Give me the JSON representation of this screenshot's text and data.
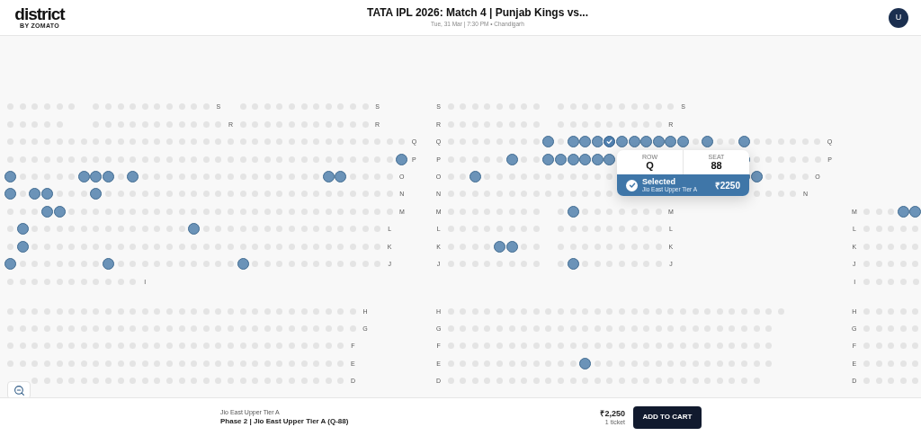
{
  "header": {
    "logo": "district",
    "logo_subtitle": "BY ZOMATO",
    "title": "TATA IPL 2026: Match 4 | Punjab Kings vs...",
    "subtitle": "Tue, 31 Mar | 7:30 PM • Chandigarh",
    "avatar": "U"
  },
  "seat_map": {
    "sections": [
      {
        "rows": [
          {
            "segments": [
              {
                "kind": "seats",
                "available": [
                  false,
                  false,
                  false,
                  false,
                  false,
                  false
                ]
              },
              {
                "kind": "space"
              },
              {
                "kind": "seats",
                "available": [
                  false,
                  false,
                  false,
                  false,
                  false,
                  false,
                  false,
                  false,
                  false,
                  false
                ]
              },
              {
                "kind": "label",
                "text": "S"
              },
              {
                "kind": "space"
              },
              {
                "kind": "seats",
                "available": [
                  false,
                  false,
                  false,
                  false,
                  false,
                  false,
                  false,
                  false,
                  false,
                  false,
                  false
                ]
              },
              {
                "kind": "label",
                "text": "S"
              },
              {
                "kind": "space"
              },
              {
                "kind": "label",
                "text": "S"
              },
              {
                "kind": "seats",
                "available": [
                  false,
                  false,
                  false,
                  false,
                  false,
                  false,
                  false,
                  false
                ]
              },
              {
                "kind": "space"
              },
              {
                "kind": "seats",
                "available": [
                  false,
                  false,
                  false,
                  false,
                  false,
                  false,
                  false,
                  false,
                  false,
                  false
                ]
              },
              {
                "kind": "label",
                "text": "S"
              }
            ]
          },
          {
            "segments": [
              {
                "kind": "seats",
                "available": [
                  false,
                  false,
                  false,
                  false,
                  false
                ]
              },
              {
                "kind": "space"
              },
              {
                "kind": "seats",
                "available": [
                  false,
                  false,
                  false,
                  false,
                  false,
                  false,
                  false,
                  false,
                  false,
                  false,
                  false
                ]
              },
              {
                "kind": "label",
                "text": "R"
              },
              {
                "kind": "seats",
                "available": [
                  false,
                  false,
                  false,
                  false,
                  false,
                  false,
                  false,
                  false,
                  false,
                  false,
                  false
                ]
              },
              {
                "kind": "label",
                "text": "R"
              },
              {
                "kind": "space"
              },
              {
                "kind": "label",
                "text": "R"
              },
              {
                "kind": "seats",
                "available": [
                  false,
                  false,
                  false,
                  false,
                  false,
                  false,
                  false,
                  false
                ]
              },
              {
                "kind": "space"
              },
              {
                "kind": "seats",
                "available": [
                  false,
                  false,
                  false,
                  false,
                  false,
                  false,
                  false,
                  false,
                  false
                ]
              },
              {
                "kind": "label",
                "text": "R"
              }
            ]
          },
          {
            "segments": [
              {
                "kind": "seats",
                "available": [
                  false,
                  false,
                  false,
                  false,
                  false,
                  false,
                  false,
                  false,
                  false,
                  false,
                  false,
                  false,
                  false,
                  false,
                  false,
                  false,
                  false,
                  false,
                  false,
                  false,
                  false,
                  false,
                  false,
                  false,
                  false,
                  false,
                  false,
                  false,
                  false,
                  false,
                  false,
                  false,
                  false
                ]
              },
              {
                "kind": "label",
                "text": "Q"
              },
              {
                "kind": "space"
              },
              {
                "kind": "label",
                "text": "Q"
              },
              {
                "kind": "seats",
                "available": [
                  false,
                  false,
                  false,
                  false,
                  false,
                  false,
                  false,
                  false,
                  true,
                  false,
                  true,
                  true,
                  true
                ]
              },
              {
                "kind": "seat",
                "selected": true
              },
              {
                "kind": "seats",
                "available": [
                  true,
                  true,
                  true,
                  true,
                  true,
                  true,
                  false,
                  true,
                  false,
                  false,
                  true,
                  false,
                  false,
                  false,
                  false,
                  false,
                  false
                ]
              },
              {
                "kind": "label",
                "text": "Q"
              }
            ]
          },
          {
            "segments": [
              {
                "kind": "seats",
                "available": [
                  false,
                  false,
                  false,
                  false,
                  false,
                  false,
                  false,
                  false,
                  false,
                  false,
                  false,
                  false,
                  false,
                  false,
                  false,
                  false,
                  false,
                  false,
                  false,
                  false,
                  false,
                  false,
                  false,
                  false,
                  false,
                  false,
                  false,
                  false,
                  false,
                  false,
                  false,
                  false,
                  true
                ]
              },
              {
                "kind": "label",
                "text": "P"
              },
              {
                "kind": "space"
              },
              {
                "kind": "label",
                "text": "P"
              },
              {
                "kind": "seats",
                "available": [
                  false,
                  false,
                  false,
                  false,
                  false,
                  true,
                  false,
                  false,
                  true,
                  true,
                  true,
                  true,
                  true,
                  true
                ]
              },
              {
                "kind": "space"
              },
              {
                "kind": "seats",
                "available": [
                  true,
                  false,
                  false,
                  false,
                  false,
                  false,
                  false
                ]
              },
              {
                "kind": "label",
                "text": "P"
              }
            ]
          },
          {
            "segments": [
              {
                "kind": "seats",
                "available": [
                  true,
                  false,
                  false,
                  false,
                  false,
                  false,
                  true,
                  true,
                  true,
                  false,
                  true,
                  false,
                  false,
                  false,
                  false,
                  false,
                  false,
                  false,
                  false,
                  false,
                  false,
                  false,
                  false,
                  false,
                  false,
                  false,
                  true,
                  true,
                  false,
                  false,
                  false,
                  false
                ]
              },
              {
                "kind": "label",
                "text": "O"
              },
              {
                "kind": "space"
              },
              {
                "kind": "label",
                "text": "O"
              },
              {
                "kind": "seats",
                "available": [
                  false,
                  false,
                  true,
                  false,
                  false,
                  false,
                  false,
                  false,
                  false,
                  false,
                  false,
                  false,
                  false,
                  false
                ]
              },
              {
                "kind": "space"
              },
              {
                "kind": "seats",
                "available": [
                  true,
                  true,
                  false,
                  false,
                  false,
                  false
                ]
              },
              {
                "kind": "label",
                "text": "O"
              }
            ]
          },
          {
            "segments": [
              {
                "kind": "seats",
                "available": [
                  true,
                  false,
                  true,
                  true,
                  false,
                  false,
                  false,
                  true,
                  false,
                  false,
                  false,
                  false,
                  false,
                  false,
                  false,
                  false,
                  false,
                  false,
                  false,
                  false,
                  false,
                  false,
                  false,
                  false,
                  false,
                  false,
                  false,
                  false,
                  false,
                  false,
                  false,
                  false
                ]
              },
              {
                "kind": "label",
                "text": "N"
              },
              {
                "kind": "space"
              },
              {
                "kind": "label",
                "text": "N"
              },
              {
                "kind": "seats",
                "available": [
                  false,
                  false,
                  false,
                  false,
                  false,
                  false,
                  false,
                  false,
                  false,
                  false,
                  false,
                  false,
                  false,
                  false
                ]
              },
              {
                "kind": "space"
              },
              {
                "kind": "seats",
                "available": [
                  false,
                  false,
                  false,
                  false
                ]
              },
              {
                "kind": "label",
                "text": "N"
              }
            ]
          },
          {
            "segments": [
              {
                "kind": "seats",
                "available": [
                  false,
                  false,
                  false,
                  true,
                  true,
                  false,
                  false,
                  false,
                  false,
                  false,
                  false,
                  false,
                  false,
                  false,
                  false,
                  false,
                  false,
                  false,
                  false,
                  false,
                  false,
                  false,
                  false,
                  false,
                  false,
                  false,
                  false,
                  false,
                  false,
                  false,
                  false,
                  false
                ]
              },
              {
                "kind": "label",
                "text": "M"
              },
              {
                "kind": "space"
              },
              {
                "kind": "label",
                "text": "M"
              },
              {
                "kind": "seats",
                "available": [
                  false,
                  false,
                  false,
                  false,
                  false,
                  false,
                  false,
                  false
                ]
              },
              {
                "kind": "space"
              },
              {
                "kind": "seats",
                "available": [
                  false,
                  true,
                  false,
                  false,
                  false,
                  false,
                  false,
                  false,
                  false
                ]
              },
              {
                "kind": "label",
                "text": "M"
              },
              {
                "kind": "space"
              },
              {
                "kind": "label",
                "text": "M"
              },
              {
                "kind": "seats",
                "available": [
                  false,
                  false,
                  false,
                  true,
                  true
                ]
              }
            ]
          },
          {
            "segments": [
              {
                "kind": "seats",
                "available": [
                  false,
                  true,
                  false,
                  false,
                  false,
                  false,
                  false,
                  false,
                  false,
                  false,
                  false,
                  false,
                  false,
                  false,
                  false,
                  true,
                  false,
                  false,
                  false,
                  false,
                  false,
                  false,
                  false,
                  false,
                  false,
                  false,
                  false,
                  false,
                  false,
                  false,
                  false
                ]
              },
              {
                "kind": "label",
                "text": "L"
              },
              {
                "kind": "space"
              },
              {
                "kind": "label",
                "text": "L"
              },
              {
                "kind": "seats",
                "available": [
                  false,
                  false,
                  false,
                  false,
                  false,
                  false,
                  false,
                  false
                ]
              },
              {
                "kind": "space"
              },
              {
                "kind": "seats",
                "available": [
                  false,
                  false,
                  false,
                  false,
                  false,
                  false,
                  false,
                  false,
                  false
                ]
              },
              {
                "kind": "label",
                "text": "L"
              },
              {
                "kind": "space"
              },
              {
                "kind": "label",
                "text": "L"
              },
              {
                "kind": "seats",
                "available": [
                  false,
                  false,
                  false,
                  false,
                  false
                ]
              }
            ]
          },
          {
            "segments": [
              {
                "kind": "seats",
                "available": [
                  false,
                  true,
                  false,
                  false,
                  false,
                  false,
                  false,
                  false,
                  false,
                  false,
                  false,
                  false,
                  false,
                  false,
                  false,
                  false,
                  false,
                  false,
                  false,
                  false,
                  false,
                  false,
                  false,
                  false,
                  false,
                  false,
                  false,
                  false,
                  false,
                  false,
                  false
                ]
              },
              {
                "kind": "label",
                "text": "K"
              },
              {
                "kind": "space"
              },
              {
                "kind": "label",
                "text": "K"
              },
              {
                "kind": "seats",
                "available": [
                  false,
                  false,
                  false,
                  false,
                  true,
                  true,
                  false,
                  false
                ]
              },
              {
                "kind": "space"
              },
              {
                "kind": "seats",
                "available": [
                  false,
                  false,
                  false,
                  false,
                  false,
                  false,
                  false,
                  false,
                  false
                ]
              },
              {
                "kind": "label",
                "text": "K"
              },
              {
                "kind": "space"
              },
              {
                "kind": "label",
                "text": "K"
              },
              {
                "kind": "seats",
                "available": [
                  false,
                  false,
                  false,
                  false,
                  false
                ]
              }
            ]
          },
          {
            "segments": [
              {
                "kind": "seats",
                "available": [
                  true,
                  false,
                  false,
                  false,
                  false,
                  false,
                  false,
                  false,
                  true,
                  false,
                  false,
                  false,
                  false,
                  false,
                  false,
                  false,
                  false,
                  false,
                  false,
                  true,
                  false,
                  false,
                  false,
                  false,
                  false,
                  false,
                  false,
                  false,
                  false,
                  false,
                  false
                ]
              },
              {
                "kind": "label",
                "text": "J"
              },
              {
                "kind": "space"
              },
              {
                "kind": "label",
                "text": "J"
              },
              {
                "kind": "seats",
                "available": [
                  false,
                  false,
                  false,
                  false,
                  false,
                  false,
                  false,
                  false
                ]
              },
              {
                "kind": "space"
              },
              {
                "kind": "seats",
                "available": [
                  false,
                  true,
                  false,
                  false,
                  false,
                  false,
                  false,
                  false,
                  false
                ]
              },
              {
                "kind": "label",
                "text": "J"
              },
              {
                "kind": "space"
              },
              {
                "kind": "label",
                "text": "J"
              },
              {
                "kind": "seats",
                "available": [
                  false,
                  false,
                  false,
                  false,
                  false
                ]
              }
            ]
          },
          {
            "segments": [
              {
                "kind": "seats",
                "available": [
                  false,
                  false,
                  false,
                  false,
                  false,
                  false,
                  false,
                  false,
                  false,
                  false,
                  false
                ]
              },
              {
                "kind": "label",
                "text": "I"
              },
              {
                "kind": "space"
              },
              {
                "kind": "label",
                "text": "I"
              },
              {
                "kind": "seats",
                "available": [
                  false,
                  false,
                  false,
                  false,
                  false
                ]
              }
            ]
          }
        ]
      },
      {
        "rows": [
          {
            "segments": [
              {
                "kind": "seats",
                "available": [
                  false,
                  false,
                  false,
                  false,
                  false,
                  false,
                  false,
                  false,
                  false,
                  false,
                  false,
                  false,
                  false,
                  false,
                  false,
                  false,
                  false,
                  false,
                  false,
                  false,
                  false,
                  false,
                  false,
                  false,
                  false,
                  false,
                  false,
                  false,
                  false
                ]
              },
              {
                "kind": "label",
                "text": "H"
              },
              {
                "kind": "space"
              },
              {
                "kind": "label",
                "text": "H"
              },
              {
                "kind": "seats",
                "available": [
                  false,
                  false,
                  false,
                  false,
                  false,
                  false,
                  false,
                  false,
                  false,
                  false,
                  false,
                  false,
                  false,
                  false,
                  false,
                  false,
                  false,
                  false,
                  false,
                  false,
                  false,
                  false,
                  false,
                  false,
                  false,
                  false,
                  false,
                  false
                ]
              },
              {
                "kind": "space"
              },
              {
                "kind": "label",
                "text": "H"
              },
              {
                "kind": "seats",
                "available": [
                  false,
                  false,
                  false,
                  false,
                  false
                ]
              }
            ]
          },
          {
            "segments": [
              {
                "kind": "seats",
                "available": [
                  false,
                  false,
                  false,
                  false,
                  false,
                  false,
                  false,
                  false,
                  false,
                  false,
                  false,
                  false,
                  false,
                  false,
                  false,
                  false,
                  false,
                  false,
                  false,
                  false,
                  false,
                  false,
                  false,
                  false,
                  false,
                  false,
                  false,
                  false,
                  false
                ]
              },
              {
                "kind": "label",
                "text": "G"
              },
              {
                "kind": "space"
              },
              {
                "kind": "label",
                "text": "G"
              },
              {
                "kind": "seats",
                "available": [
                  false,
                  false,
                  false,
                  false,
                  false,
                  false,
                  false,
                  false,
                  false,
                  false,
                  false,
                  false,
                  false,
                  false,
                  false,
                  false,
                  false,
                  false,
                  false,
                  false,
                  false,
                  false,
                  false,
                  false,
                  false,
                  false,
                  false
                ]
              },
              {
                "kind": "space"
              },
              {
                "kind": "label",
                "text": "G"
              },
              {
                "kind": "seats",
                "available": [
                  false,
                  false,
                  false,
                  false,
                  false
                ]
              }
            ]
          },
          {
            "segments": [
              {
                "kind": "seats",
                "available": [
                  false,
                  false,
                  false,
                  false,
                  false,
                  false,
                  false,
                  false,
                  false,
                  false,
                  false,
                  false,
                  false,
                  false,
                  false,
                  false,
                  false,
                  false,
                  false,
                  false,
                  false,
                  false,
                  false,
                  false,
                  false,
                  false,
                  false,
                  false
                ]
              },
              {
                "kind": "label",
                "text": "F"
              },
              {
                "kind": "space"
              },
              {
                "kind": "label",
                "text": "F"
              },
              {
                "kind": "seats",
                "available": [
                  false,
                  false,
                  false,
                  false,
                  false,
                  false,
                  false,
                  false,
                  false,
                  false,
                  false,
                  false,
                  false,
                  false,
                  false,
                  false,
                  false,
                  false,
                  false,
                  false,
                  false,
                  false,
                  false,
                  false,
                  false,
                  false,
                  false
                ]
              },
              {
                "kind": "space"
              },
              {
                "kind": "label",
                "text": "F"
              },
              {
                "kind": "seats",
                "available": [
                  false,
                  false,
                  false,
                  false,
                  false
                ]
              }
            ]
          },
          {
            "segments": [
              {
                "kind": "seats",
                "available": [
                  false,
                  false,
                  false,
                  false,
                  false,
                  false,
                  false,
                  false,
                  false,
                  false,
                  false,
                  false,
                  false,
                  false,
                  false,
                  false,
                  false,
                  false,
                  false,
                  false,
                  false,
                  false,
                  false,
                  false,
                  false,
                  false,
                  false,
                  false
                ]
              },
              {
                "kind": "label",
                "text": "E"
              },
              {
                "kind": "space"
              },
              {
                "kind": "label",
                "text": "E"
              },
              {
                "kind": "seats",
                "available": [
                  false,
                  false,
                  false,
                  false,
                  false,
                  false,
                  false,
                  false,
                  false,
                  false,
                  false,
                  true,
                  false,
                  false,
                  false,
                  false,
                  false,
                  false,
                  false,
                  false,
                  false,
                  false,
                  false,
                  false,
                  false,
                  false,
                  false
                ]
              },
              {
                "kind": "space"
              },
              {
                "kind": "label",
                "text": "E"
              },
              {
                "kind": "seats",
                "available": [
                  false,
                  false,
                  false,
                  false,
                  false
                ]
              }
            ]
          },
          {
            "segments": [
              {
                "kind": "space"
              },
              {
                "kind": "seats",
                "available": [
                  false,
                  false,
                  false,
                  false,
                  false,
                  false,
                  false,
                  false,
                  false,
                  false,
                  false,
                  false,
                  false,
                  false,
                  false,
                  false,
                  false,
                  false,
                  false,
                  false,
                  false,
                  false,
                  false,
                  false,
                  false,
                  false
                ]
              },
              {
                "kind": "label",
                "text": "D"
              },
              {
                "kind": "space"
              },
              {
                "kind": "label",
                "text": "D"
              },
              {
                "kind": "seats",
                "available": [
                  false,
                  false,
                  false,
                  false,
                  false,
                  false,
                  false,
                  false,
                  false,
                  false,
                  false,
                  false,
                  false,
                  false,
                  false,
                  false,
                  false,
                  false,
                  false,
                  false,
                  false,
                  false,
                  false,
                  false,
                  false,
                  false
                ]
              },
              {
                "kind": "space"
              },
              {
                "kind": "label",
                "text": "D"
              },
              {
                "kind": "seats",
                "available": [
                  false,
                  false,
                  false,
                  false,
                  false
                ]
              }
            ]
          }
        ]
      }
    ]
  },
  "tooltip": {
    "row_label": "ROW",
    "row": "Q",
    "seat_label": "SEAT",
    "seat": "88",
    "status": "Selected",
    "stand": "Jio East Upper Tier A",
    "price": "₹2250"
  },
  "footer": {
    "stand": "Jio East Upper Tier A",
    "selection": "Phase 2 | Jio East Upper Tier A (Q-88)",
    "price": "₹2,250",
    "count": "1 ticket",
    "button": "ADD TO CART"
  }
}
